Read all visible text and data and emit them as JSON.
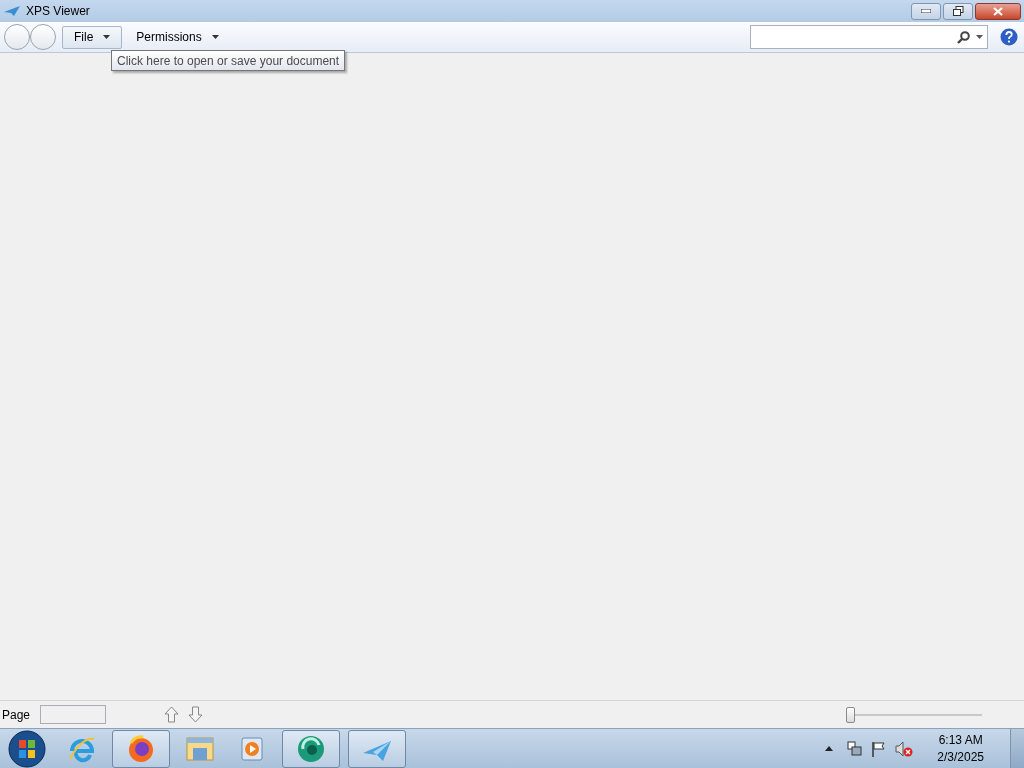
{
  "window": {
    "title": "XPS Viewer"
  },
  "toolbar": {
    "menus": [
      {
        "label": "File",
        "selected": true
      },
      {
        "label": "Permissions",
        "selected": false
      }
    ],
    "tooltip": "Click here to open or save your document"
  },
  "status_bar": {
    "page_label": "Page",
    "zoom": {
      "level": 0
    }
  },
  "taskbar": {
    "items": [
      {
        "kind": "ie",
        "running": false
      },
      {
        "kind": "firefox",
        "running": true
      },
      {
        "kind": "explorer",
        "running": false
      },
      {
        "kind": "media",
        "running": false
      },
      {
        "kind": "green",
        "running": true
      },
      {
        "kind": "xps",
        "running": true
      }
    ],
    "clock": {
      "time": "6:13 AM",
      "date": "2/3/2025"
    }
  }
}
